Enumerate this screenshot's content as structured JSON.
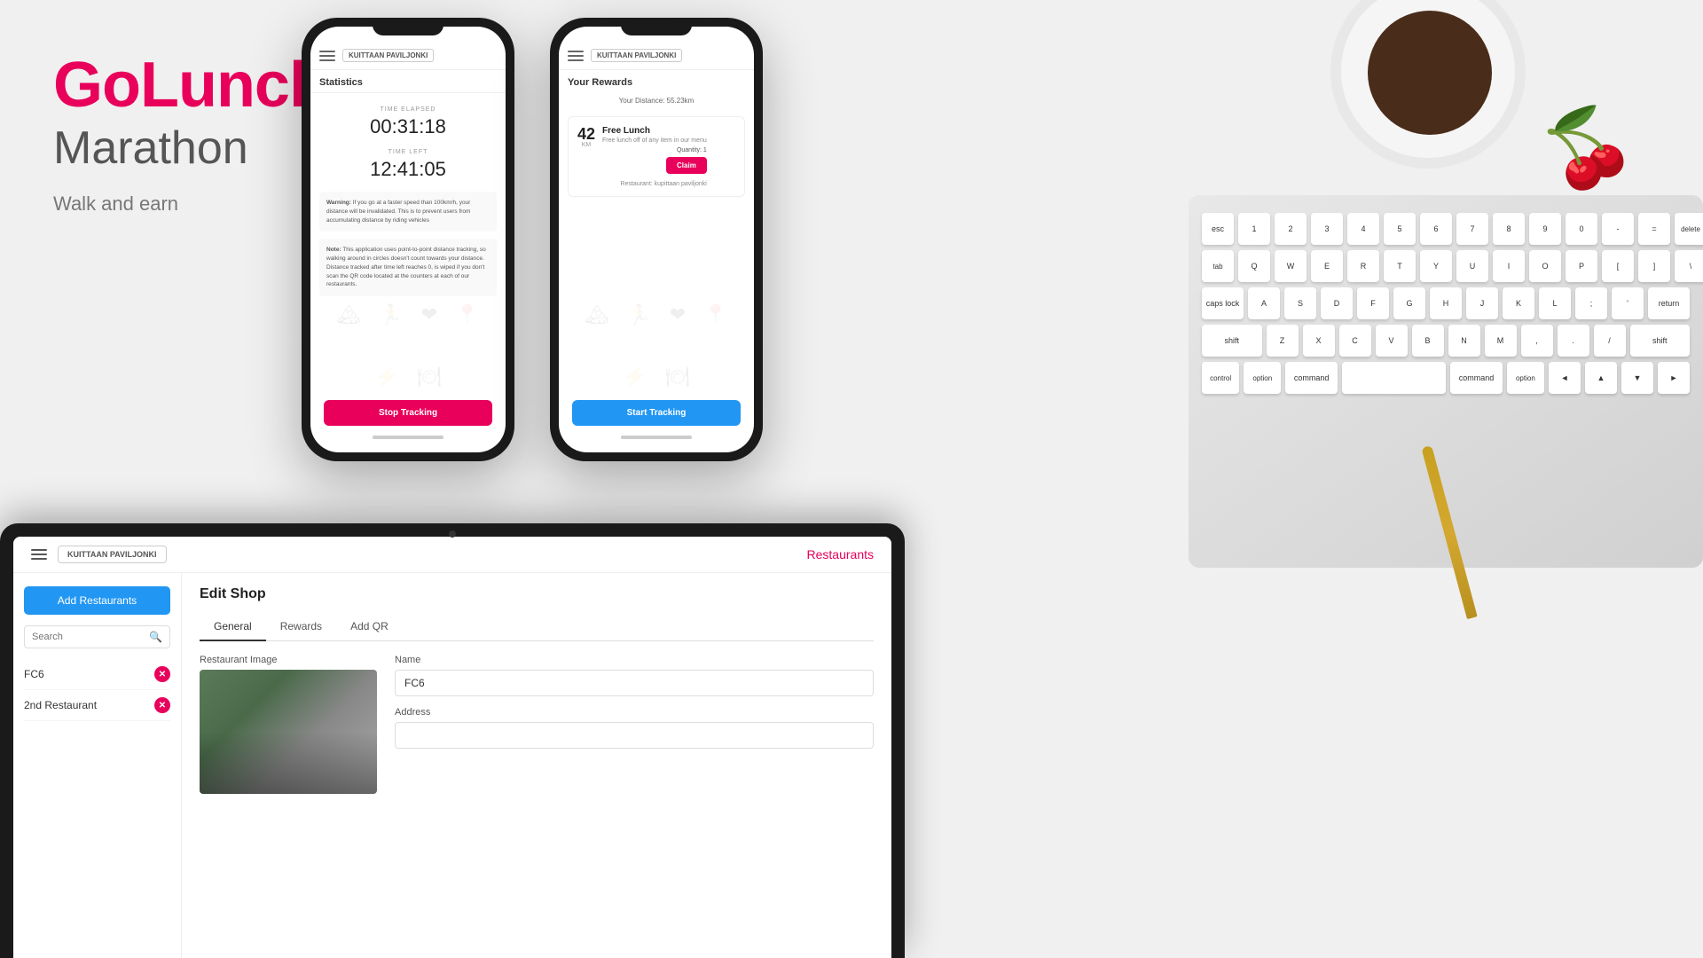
{
  "app": {
    "title": "GoLunch",
    "subtitle": "Marathon",
    "tagline": "Walk and earn"
  },
  "phone1": {
    "header_logo": "KUITTAAN PAVILJONKI",
    "screen_title": "Statistics",
    "time_elapsed_label": "TIME ELAPSED",
    "time_elapsed_value": "00:31:18",
    "time_left_label": "TIME LEFT",
    "time_left_value": "12:41:05",
    "warning_title": "Warning:",
    "warning_text": "If you go at a faster speed than 100km/h, your distance will be invalidated. This is to prevent users from accumulating distance by riding vehicles",
    "note_title": "Note:",
    "note_text": "This application uses point-to-point distance tracking, so walking around in circles doesn't count towards your distance. Distance tracked after time left reaches 0, is wiped if you don't scan the QR code located at the counters at each of our restaurants.",
    "stop_button": "Stop Tracking"
  },
  "phone2": {
    "header_logo": "KUITTAAN PAVILJONKI",
    "screen_title": "Your Rewards",
    "distance_text": "Your Distance: 55.23km",
    "km_value": "42",
    "km_label": "KM",
    "reward_title": "Free Lunch",
    "reward_desc": "Free lunch off of any item in our menu",
    "quantity_label": "Quantity: 1",
    "claim_button": "Claim",
    "restaurant_label": "Restaurant: kupittaan paviljonki",
    "start_button": "Start Tracking"
  },
  "tablet": {
    "restaurants_link": "Restaurants",
    "logo_text": "KUITTAAN PAVILJONKI",
    "add_restaurants_button": "Add Restaurants",
    "search_placeholder": "Search",
    "restaurant_list": [
      {
        "name": "FC6",
        "id": "fc6"
      },
      {
        "name": "2nd Restaurant",
        "id": "2nd-restaurant"
      }
    ],
    "edit_shop_title": "Edit Shop",
    "tabs": [
      {
        "label": "General",
        "active": true
      },
      {
        "label": "Rewards",
        "active": false
      },
      {
        "label": "Add QR",
        "active": false
      }
    ],
    "form": {
      "restaurant_image_label": "Restaurant Image",
      "name_label": "Name",
      "name_value": "FC6",
      "address_label": "Address"
    }
  },
  "keyboard_keys": {
    "row1": [
      "esc",
      "1",
      "2",
      "3",
      "4",
      "5",
      "6",
      "7",
      "8",
      "9",
      "0",
      "-",
      "=",
      "delete"
    ],
    "row2": [
      "tab",
      "Q",
      "W",
      "E",
      "R",
      "T",
      "Y",
      "U",
      "I",
      "O",
      "P",
      "[",
      "]",
      "\\"
    ],
    "row3": [
      "caps lock",
      "A",
      "S",
      "D",
      "F",
      "G",
      "H",
      "J",
      "K",
      "L",
      ";",
      "'",
      "return"
    ],
    "row4": [
      "shift",
      "Z",
      "X",
      "C",
      "V",
      "B",
      "N",
      "M",
      ",",
      ".",
      "/",
      "shift"
    ],
    "row5": [
      "control",
      "option",
      "command",
      "",
      "command",
      "option",
      "◄",
      "▲",
      "▼",
      "►"
    ]
  }
}
